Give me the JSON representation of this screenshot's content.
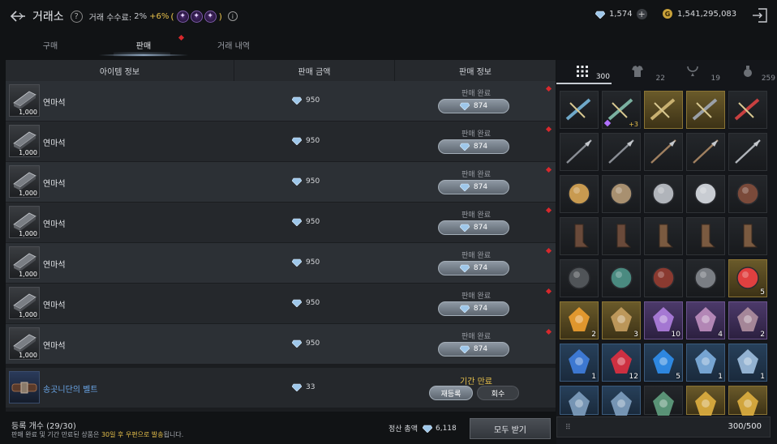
{
  "header": {
    "title": "거래소",
    "fee_label": "거래 수수료:",
    "fee_value": "2%",
    "fee_bonus": "+6%",
    "paren_open": "(",
    "paren_close": ")",
    "diamond_amount": "1,574",
    "silver_amount": "1,541,295,083"
  },
  "tabs": [
    {
      "label": "구매"
    },
    {
      "label": "판매"
    },
    {
      "label": "거래 내역"
    }
  ],
  "table": {
    "columns": [
      "아이템 정보",
      "판매 금액",
      "판매 정보"
    ],
    "rows": [
      {
        "name": "연마석",
        "count": "1,000",
        "price": "950",
        "status": "판매 완료",
        "amount": "874"
      },
      {
        "name": "연마석",
        "count": "1,000",
        "price": "950",
        "status": "판매 완료",
        "amount": "874"
      },
      {
        "name": "연마석",
        "count": "1,000",
        "price": "950",
        "status": "판매 완료",
        "amount": "874"
      },
      {
        "name": "연마석",
        "count": "1,000",
        "price": "950",
        "status": "판매 완료",
        "amount": "874"
      },
      {
        "name": "연마석",
        "count": "1,000",
        "price": "950",
        "status": "판매 완료",
        "amount": "874"
      },
      {
        "name": "연마석",
        "count": "1,000",
        "price": "950",
        "status": "판매 완료",
        "amount": "874"
      },
      {
        "name": "연마석",
        "count": "1,000",
        "price": "950",
        "status": "판매 완료",
        "amount": "874"
      }
    ],
    "expired_row": {
      "name": "송곳니단의 벨트",
      "price": "33",
      "status": "기간 만료",
      "relist_label": "재등록",
      "retrieve_label": "회수"
    }
  },
  "footer": {
    "registered": "등록 개수 (29/30)",
    "notice_a": "판매 완료 및 기간 만료된 상품은 ",
    "notice_b": "30일 후 우편으로 발송",
    "notice_c": "됩니다.",
    "settle_label": "정산 총액",
    "settle_value": "6,118",
    "receive_all": "모두 받기"
  },
  "inventory": {
    "tabs": [
      {
        "icon": "grid-icon",
        "count": "300"
      },
      {
        "icon": "armor-icon",
        "count": "22"
      },
      {
        "icon": "necklace-icon",
        "count": "19"
      },
      {
        "icon": "potion-icon",
        "count": "259"
      }
    ],
    "capacity": "300/500",
    "slot_qty": {
      "r0c1": "+3",
      "r4c4": "5",
      "r5c0": "2",
      "r5c1": "3",
      "r5c2": "10",
      "r5c3": "4",
      "r5c4": "2",
      "r6c0": "1",
      "r6c1": "12",
      "r6c2": "5",
      "r6c3": "1",
      "r6c4": "1"
    }
  },
  "colors": {
    "accent_gold": "#e7c04b",
    "status_red": "#d8282c",
    "pill_gray": "#8e98a3"
  }
}
